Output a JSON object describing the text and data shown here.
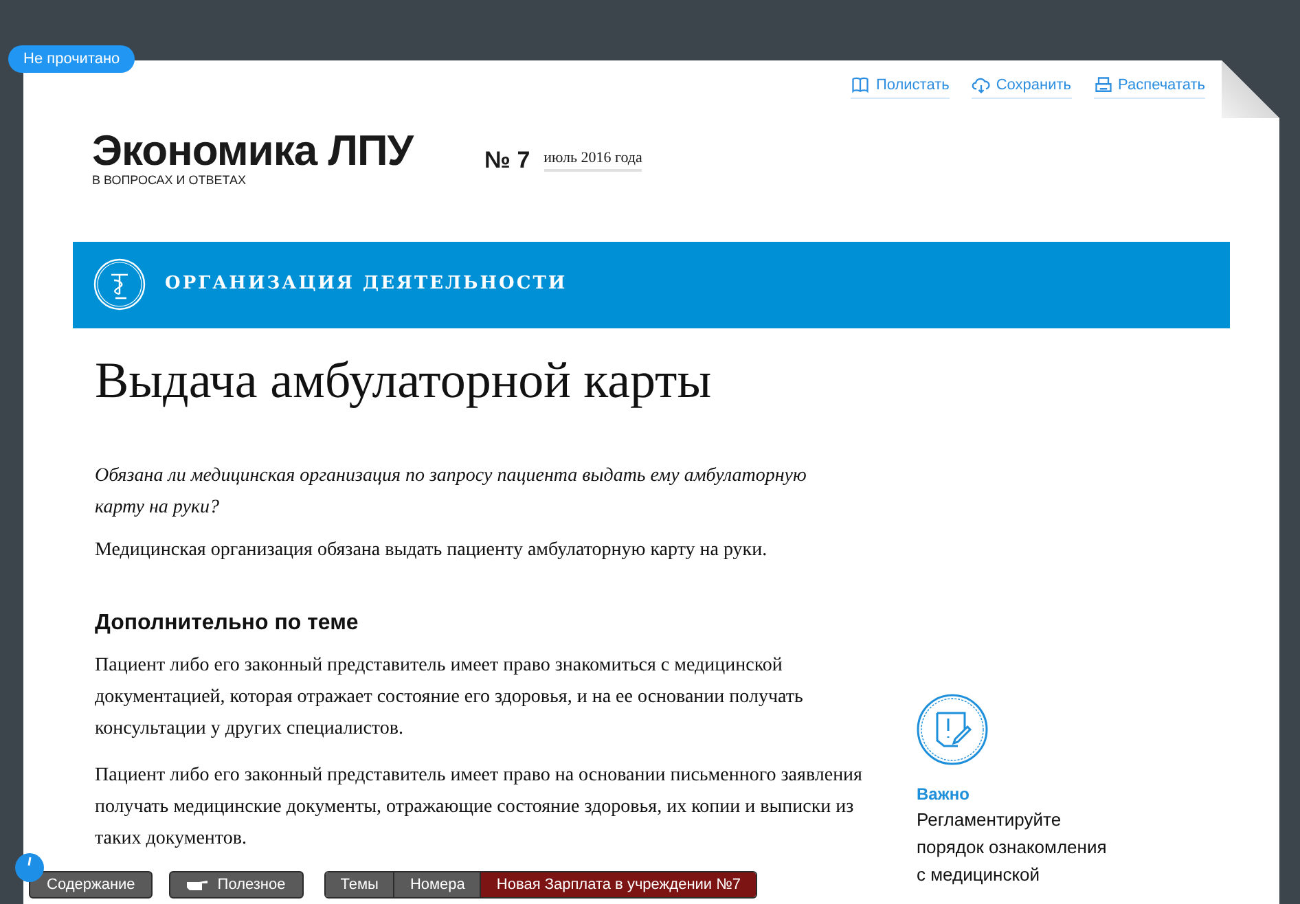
{
  "badge": "Не прочитано",
  "actions": [
    {
      "kind": "book",
      "label": "Полистать"
    },
    {
      "kind": "cloud",
      "label": "Сохранить"
    },
    {
      "kind": "print",
      "label": "Распечатать"
    }
  ],
  "logo": {
    "title": "Экономика ЛПУ",
    "subtitle": "В ВОПРОСАХ И ОТВЕТАХ"
  },
  "issue": {
    "number": "№ 7",
    "date": "июль 2016 года"
  },
  "section": "ОРГАНИЗАЦИЯ ДЕЯТЕЛЬНОСТИ",
  "title": "Выдача амбулаторной карты",
  "question": "Обязана ли медицинская организация по запросу пациента выдать ему амбулаторную карту на руки?",
  "answer": "Медицинская организация обязана выдать пациенту амбулаторную карту на руки.",
  "subheading": "Дополнительно по теме",
  "paragraphs": [
    "Пациент либо его законный представитель имеет право знакомиться с медицинской документацией, которая отражает состояние его здоровья, и на ее основании получать консультации у других специалистов.",
    "Пациент либо его законный представитель имеет право на основании письменного заявления получать медицинские документы, отражающие состояние здоровья, их копии и выписки из таких документов."
  ],
  "aside": {
    "label": "Важно",
    "text": "Регламентируйте порядок ознакомления с медицинской"
  },
  "toolbar_left": [
    {
      "kind": "plain",
      "label": "Содержание"
    },
    {
      "kind": "hand",
      "label": "Полезное"
    }
  ],
  "toolbar_right": [
    {
      "selected": false,
      "label": "Темы"
    },
    {
      "selected": false,
      "label": "Номера"
    },
    {
      "selected": true,
      "label": "Новая Зарплата в учреждении №7"
    }
  ]
}
